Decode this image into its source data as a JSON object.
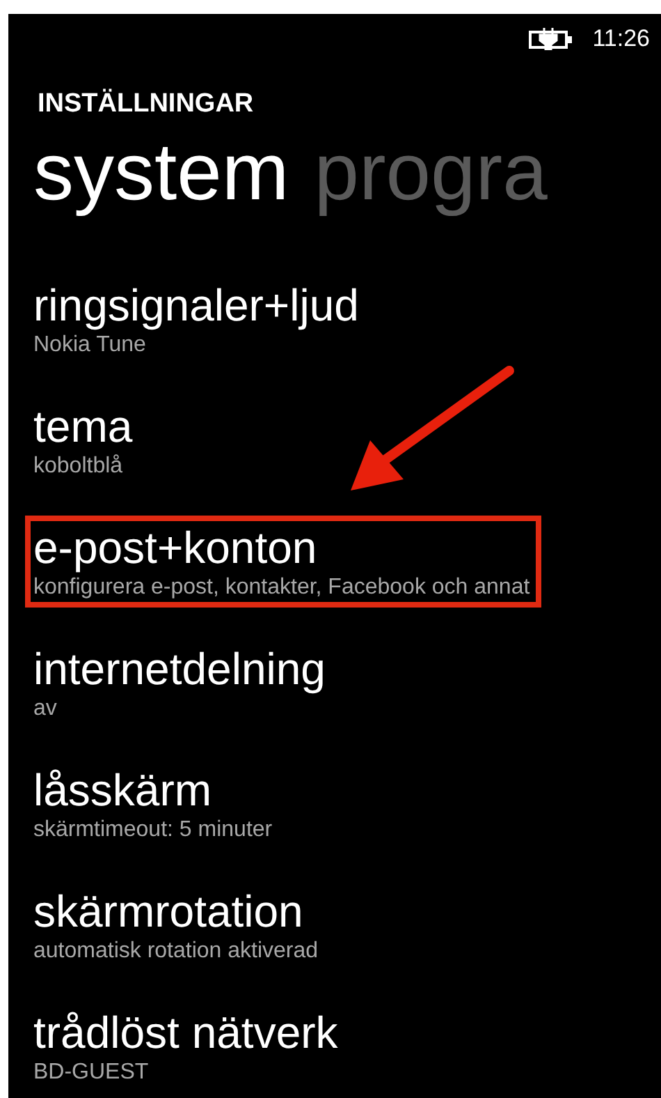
{
  "status_bar": {
    "time": "11:26"
  },
  "app_title": "INSTÄLLNINGAR",
  "pivots": [
    {
      "label": "system",
      "selected": true
    },
    {
      "label": "progra",
      "selected": false
    }
  ],
  "items": [
    {
      "title": "ringsignaler+ljud",
      "subtitle": "Nokia Tune",
      "highlighted": false
    },
    {
      "title": "tema",
      "subtitle": "koboltblå",
      "highlighted": false
    },
    {
      "title": "e-post+konton",
      "subtitle": "konfigurera e-post, kontakter, Facebook och annat",
      "highlighted": true
    },
    {
      "title": "internetdelning",
      "subtitle": "av",
      "highlighted": false
    },
    {
      "title": "låsskärm",
      "subtitle": "skärmtimeout: 5 minuter",
      "highlighted": false
    },
    {
      "title": "skärmrotation",
      "subtitle": "automatisk rotation aktiverad",
      "highlighted": false
    },
    {
      "title": "trådlöst nätverk",
      "subtitle": "BD-GUEST",
      "highlighted": false
    }
  ]
}
